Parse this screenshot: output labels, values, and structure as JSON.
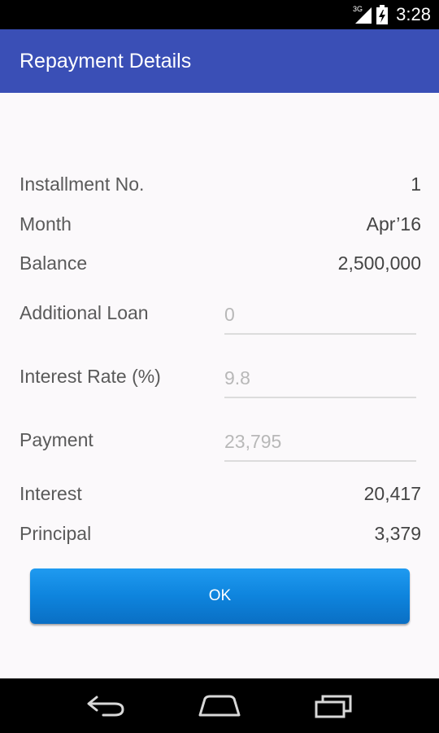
{
  "status_bar": {
    "time": "3:28",
    "network_label": "3G",
    "icons": [
      "signal-icon",
      "battery-icon"
    ]
  },
  "action_bar": {
    "title": "Repayment Details"
  },
  "details": {
    "installment": {
      "label": "Installment No.",
      "value": "1"
    },
    "month": {
      "label": "Month",
      "value": "Apr’16"
    },
    "balance": {
      "label": "Balance",
      "value": "2,500,000"
    }
  },
  "fields": {
    "additional_loan": {
      "label": "Additional Loan",
      "placeholder": "0"
    },
    "interest_rate": {
      "label": "Interest Rate (%)",
      "placeholder": "9.8"
    },
    "payment": {
      "label": "Payment",
      "placeholder": "23,795"
    }
  },
  "results": {
    "interest": {
      "label": "Interest",
      "value": "20,417"
    },
    "principal": {
      "label": "Principal",
      "value": "3,379"
    }
  },
  "ok_button": {
    "label": "OK"
  },
  "nav_bar": {
    "icons": [
      "back-icon",
      "home-icon",
      "recents-icon"
    ]
  }
}
